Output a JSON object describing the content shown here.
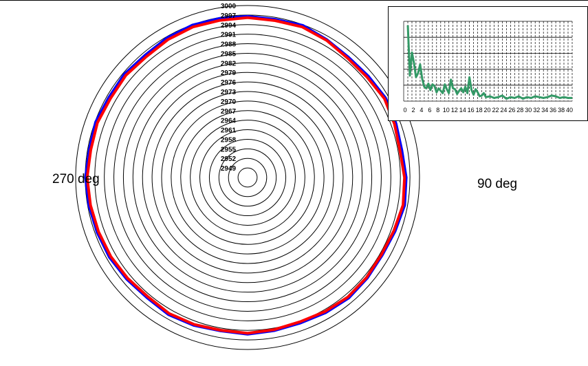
{
  "chart_data": [
    {
      "type": "polar-line",
      "radial_ticks": [
        2949,
        2952,
        2955,
        2958,
        2961,
        2964,
        2967,
        2970,
        2973,
        2976,
        2979,
        2982,
        2985,
        2988,
        2991,
        2994,
        2997,
        3000
      ],
      "rlim": [
        2946,
        3000
      ],
      "angle_labels": {
        "left": "270 deg",
        "right": "90 deg"
      },
      "grid": true,
      "series": [
        {
          "color": "#0000ff",
          "theta": [
            0,
            10,
            20,
            30,
            40,
            50,
            60,
            70,
            80,
            90,
            100,
            110,
            120,
            130,
            140,
            150,
            160,
            170,
            180,
            190,
            200,
            210,
            220,
            230,
            240,
            250,
            260,
            270,
            280,
            290,
            300,
            310,
            320,
            330,
            340,
            350
          ],
          "r": [
            2996.6,
            2996.4,
            2996.8,
            2995.9,
            2995.3,
            2995.5,
            2996.0,
            2995.6,
            2995.2,
            2995.8,
            2996.1,
            2995.3,
            2994.8,
            2995.1,
            2995.4,
            2995.0,
            2994.6,
            2994.8,
            2995.2,
            2994.9,
            2995.4,
            2995.7,
            2995.2,
            2995.6,
            2996.1,
            2996.3,
            2996.6,
            2996.9,
            2996.5,
            2996.8,
            2996.3,
            2996.5,
            2996.1,
            2996.6,
            2996.9,
            2996.7
          ]
        },
        {
          "color": "#ff0000",
          "theta": [
            0,
            10,
            20,
            30,
            40,
            50,
            60,
            70,
            80,
            90,
            100,
            110,
            120,
            130,
            140,
            150,
            160,
            170,
            180,
            190,
            200,
            210,
            220,
            230,
            240,
            250,
            260,
            270,
            280,
            290,
            300,
            310,
            320,
            330,
            340,
            350
          ],
          "r": [
            2996.2,
            2996.0,
            2996.3,
            2995.7,
            2994.9,
            2995.0,
            2995.6,
            2995.1,
            2994.6,
            2995.3,
            2995.6,
            2994.9,
            2994.5,
            2994.8,
            2995.0,
            2994.6,
            2994.2,
            2994.5,
            2994.9,
            2994.7,
            2995.1,
            2995.3,
            2994.8,
            2995.2,
            2995.6,
            2995.8,
            2996.1,
            2996.4,
            2996.0,
            2996.2,
            2995.7,
            2995.9,
            2995.5,
            2996.0,
            2996.3,
            2996.1
          ]
        }
      ]
    },
    {
      "type": "line",
      "x_ticks": [
        "0",
        "2",
        "4",
        "6",
        "8",
        "10",
        "12",
        "14",
        "16",
        "18",
        "20",
        "22",
        "24",
        "26",
        "28",
        "30",
        "32",
        "34",
        "36",
        "38",
        "40"
      ],
      "xlim": [
        0,
        41
      ],
      "ylim": [
        0,
        10
      ],
      "grid": true,
      "series": [
        {
          "color": "#339966",
          "x": [
            1,
            1.5,
            2,
            2.5,
            3,
            3.5,
            4,
            4.5,
            5,
            5.5,
            6,
            6.5,
            7,
            7.5,
            8,
            8.5,
            9,
            9.5,
            10,
            10.5,
            11,
            11.5,
            12,
            12.5,
            13,
            13.5,
            14,
            14.5,
            15,
            15.5,
            16,
            16.5,
            17,
            17.5,
            18,
            18.5,
            19,
            19.5,
            20,
            21,
            22,
            23,
            24,
            25,
            26,
            27,
            28,
            29,
            30,
            31,
            32,
            33,
            34,
            35,
            36,
            37,
            38,
            39,
            40,
            41
          ],
          "y": [
            9.5,
            3.2,
            6.1,
            4.8,
            3.0,
            3.5,
            4.6,
            2.8,
            1.8,
            1.6,
            2.2,
            1.4,
            2.1,
            1.9,
            1.1,
            1.6,
            1.3,
            1.0,
            2.1,
            1.5,
            1.0,
            2.7,
            1.6,
            1.5,
            0.9,
            1.3,
            1.6,
            1.1,
            1.8,
            1.0,
            3.0,
            1.4,
            0.8,
            1.5,
            1.1,
            0.6,
            0.7,
            1.0,
            0.5,
            0.6,
            0.4,
            0.5,
            0.7,
            0.3,
            0.5,
            0.4,
            0.6,
            0.3,
            0.5,
            0.4,
            0.6,
            0.5,
            0.4,
            0.5,
            0.7,
            0.6,
            0.4,
            0.5,
            0.4,
            0.4
          ]
        }
      ]
    }
  ]
}
